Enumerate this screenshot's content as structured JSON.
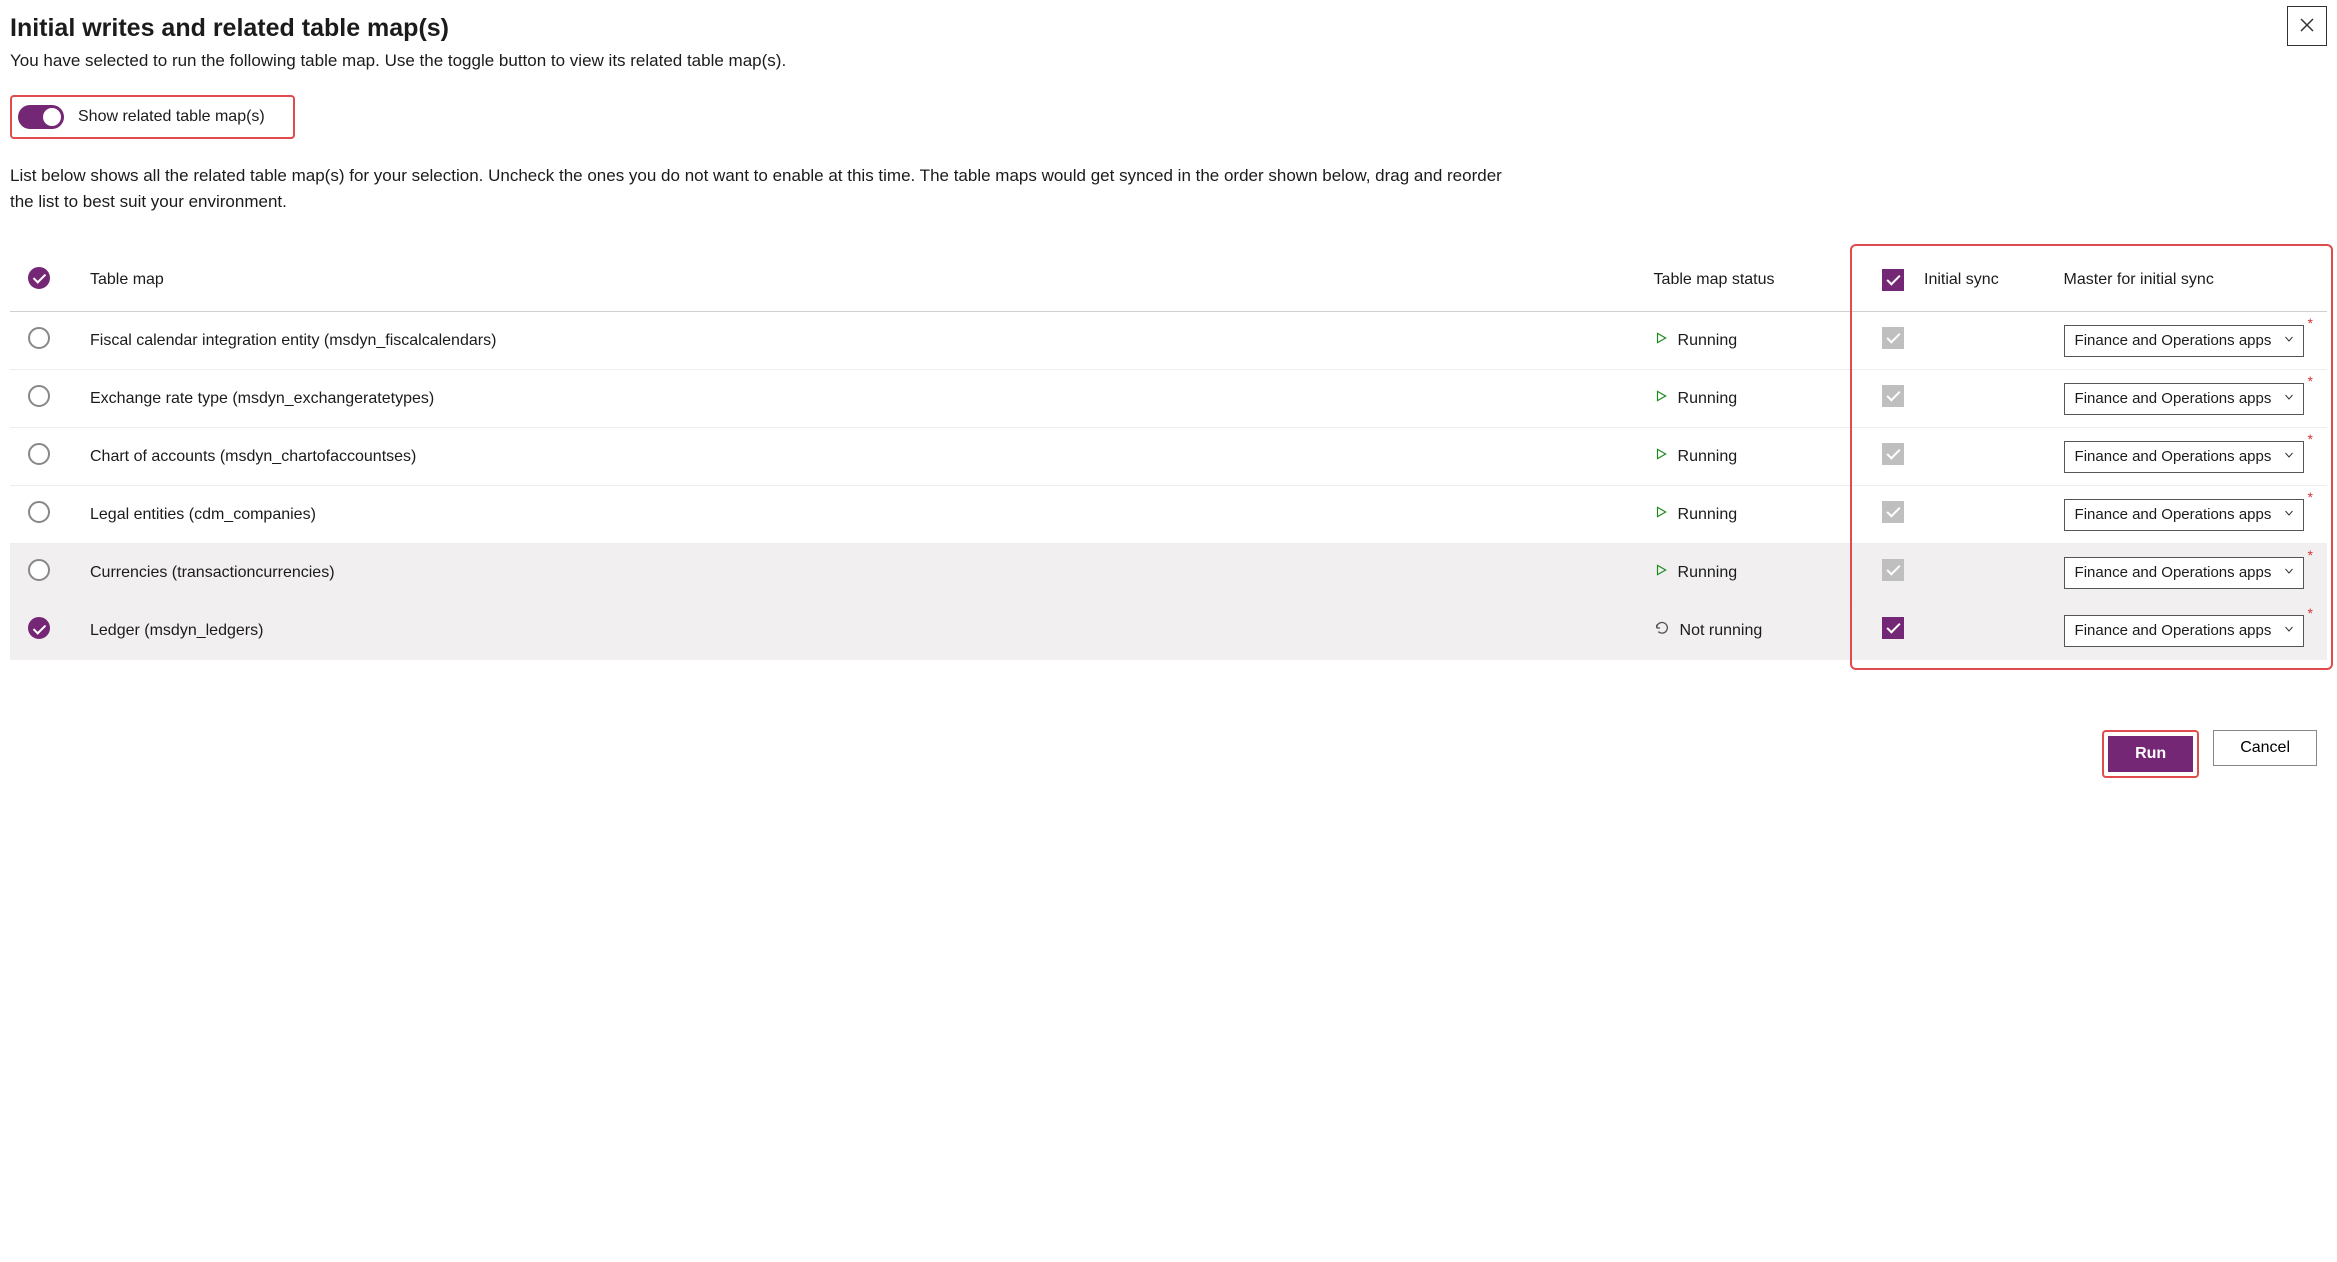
{
  "colors": {
    "accent": "#742774",
    "highlight": "#e04c4c"
  },
  "dialog": {
    "title": "Initial writes and related table map(s)",
    "subtitle": "You have selected to run the following table map. Use the toggle button to view its related table map(s).",
    "toggle_label": "Show related table map(s)",
    "toggle_on": true,
    "description": "List below shows all the related table map(s) for your selection. Uncheck the ones you do not want to enable at this time. The table maps would get synced in the order shown below, drag and reorder the list to best suit your environment."
  },
  "columns": {
    "table_map": "Table map",
    "table_map_status": "Table map status",
    "initial_sync": "Initial sync",
    "master": "Master for initial sync"
  },
  "header": {
    "select_all_checked": true,
    "initial_sync_header_checked": true
  },
  "status_labels": {
    "running": "Running",
    "not_running": "Not running"
  },
  "master_default": "Finance and Operations apps",
  "rows": [
    {
      "selected": false,
      "name": "Fiscal calendar integration entity (msdyn_fiscalcalendars)",
      "status": "running",
      "sync_state": "muted",
      "master": "Finance and Operations apps",
      "required": true,
      "shade": false
    },
    {
      "selected": false,
      "name": "Exchange rate type (msdyn_exchangeratetypes)",
      "status": "running",
      "sync_state": "muted",
      "master": "Finance and Operations apps",
      "required": true,
      "shade": false
    },
    {
      "selected": false,
      "name": "Chart of accounts (msdyn_chartofaccountses)",
      "status": "running",
      "sync_state": "muted",
      "master": "Finance and Operations apps",
      "required": true,
      "shade": false
    },
    {
      "selected": false,
      "name": "Legal entities (cdm_companies)",
      "status": "running",
      "sync_state": "muted",
      "master": "Finance and Operations apps",
      "required": true,
      "shade": false
    },
    {
      "selected": false,
      "name": "Currencies (transactioncurrencies)",
      "status": "running",
      "sync_state": "muted",
      "master": "Finance and Operations apps",
      "required": true,
      "shade": true
    },
    {
      "selected": true,
      "name": "Ledger (msdyn_ledgers)",
      "status": "not_running",
      "sync_state": "on",
      "master": "Finance and Operations apps",
      "required": true,
      "shade": true
    }
  ],
  "buttons": {
    "run": "Run",
    "cancel": "Cancel"
  }
}
